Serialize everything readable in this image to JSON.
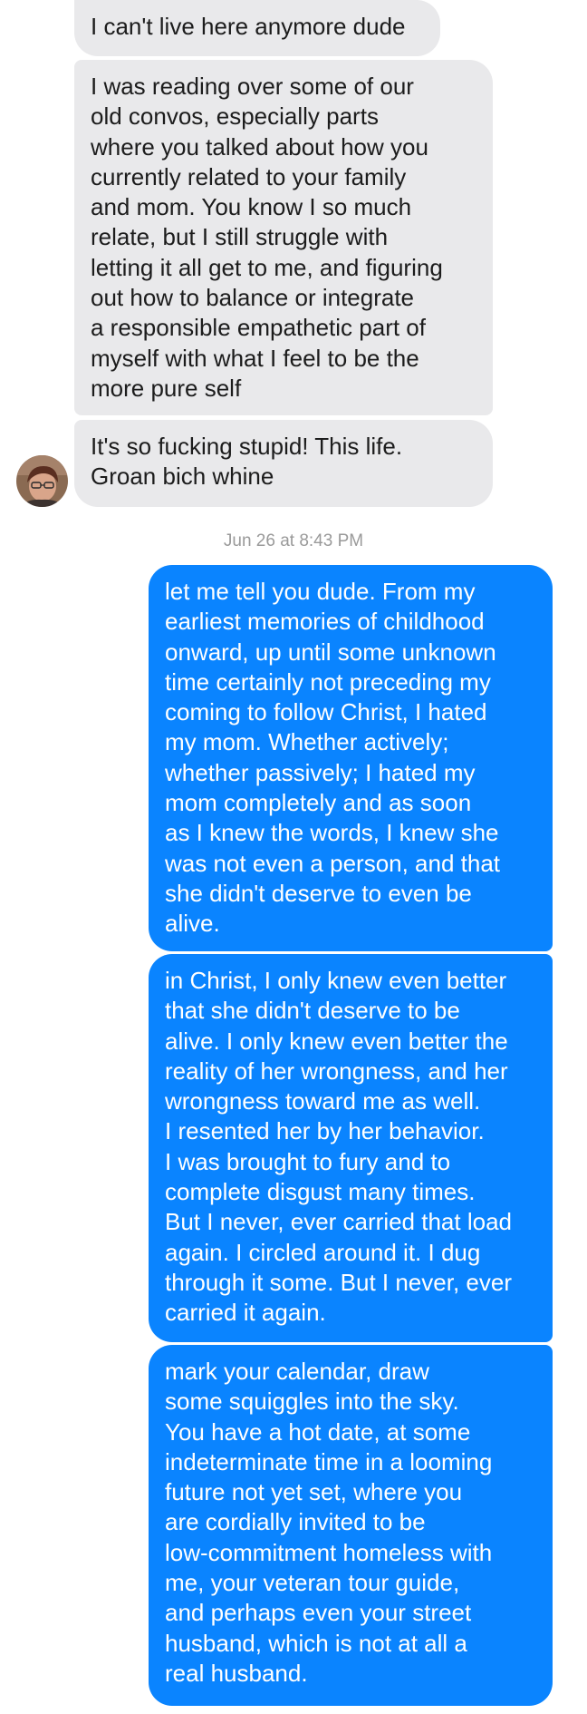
{
  "timestamp": "Jun 26 at 8:43 PM",
  "incoming": [
    "I can't live here anymore dude",
    "I was reading over some of our\nold convos, especially parts\nwhere you talked about how you\ncurrently related to your family\nand mom. You know I so much\nrelate, but I still struggle with\nletting it all get to me, and figuring\nout how to balance or integrate\na responsible empathetic part of\nmyself with what I feel to be the\nmore pure self",
    "It's so fucking stupid! This life.\nGroan bich whine"
  ],
  "outgoing": [
    "let me tell you dude. From my\nearliest memories of childhood\nonward, up until some unknown\ntime certainly not preceding my\ncoming to follow Christ, I hated\nmy mom. Whether actively;\nwhether passively; I hated my\nmom completely and as soon\nas I knew the words, I knew she\nwas not even a person, and that\nshe didn't deserve to even be\nalive.",
    "in Christ, I only knew even better\nthat she didn't deserve to be\nalive. I only knew even better the\nreality of her wrongness, and her\nwrongness toward me as well.\nI resented her by her behavior.\nI was brought to fury and to\ncomplete disgust many times.\nBut I never, ever carried that load\nagain. I circled around it. I dug\nthrough it some. But I never, ever\ncarried it again.",
    "mark your calendar, draw\nsome squiggles into the sky.\nYou have a hot date, at some\nindeterminate time in a looming\nfuture not yet set, where you\nare cordially invited to be\nlow-commitment homeless with\nme, your veteran tour guide,\nand perhaps even your street\nhusband, which is not at all a\nreal husband."
  ]
}
